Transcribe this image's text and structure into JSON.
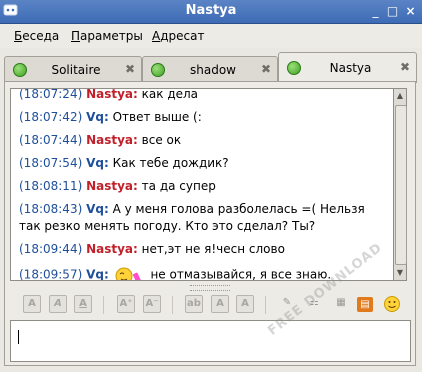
{
  "window": {
    "title": "Nastya"
  },
  "menu": [
    {
      "accel": "Б",
      "rest": "еседа"
    },
    {
      "accel": "П",
      "rest": "араметры"
    },
    {
      "accel": "А",
      "rest": "дресат"
    }
  ],
  "tabs": [
    {
      "label": "Solitaire",
      "active": false
    },
    {
      "label": "shadow",
      "active": false
    },
    {
      "label": "Nastya",
      "active": true
    }
  ],
  "messages": [
    {
      "time": "(18:07:24)",
      "nick": "Nastya:",
      "text": "как дела",
      "who": "n"
    },
    {
      "time": "(18:07:42)",
      "nick": "Vq:",
      "text": "Ответ выше (:",
      "who": "v"
    },
    {
      "time": "(18:07:44)",
      "nick": "Nastya:",
      "text": "все ок",
      "who": "n"
    },
    {
      "time": "(18:07:54)",
      "nick": "Vq:",
      "text": "Как тебе дождик?",
      "who": "v"
    },
    {
      "time": "(18:08:11)",
      "nick": "Nastya:",
      "text": "та да супер",
      "who": "n"
    },
    {
      "time": "(18:08:43)",
      "nick": "Vq:",
      "text": "А у меня голова разболелась =( Нельзя так резко менять погоду. Кто это сделал? Ты?",
      "who": "v"
    },
    {
      "time": "(18:09:44)",
      "nick": "Nastya:",
      "text": "нет,эт не я!чесн слово",
      "who": "n"
    },
    {
      "time": "(18:09:57)",
      "nick": "Vq:",
      "text": "не отмазывайся, я все знаю.",
      "who": "v",
      "smiley": "shy-smiley-icon"
    }
  ],
  "toolbar": {
    "buttons": [
      "bold-icon",
      "italic-icon",
      "underline-icon",
      "font-larger-icon",
      "font-smaller-icon",
      "font-face-icon",
      "text-color-icon",
      "background-color-icon",
      "link-icon",
      "image-icon",
      "insert-image-icon",
      "smiley-icon"
    ]
  },
  "watermark": "FREE DOWNLOAD",
  "colors": {
    "titlebar": "#4a76bd",
    "nick_nastya": "#c1202a",
    "nick_vq": "#1f4f9a"
  }
}
